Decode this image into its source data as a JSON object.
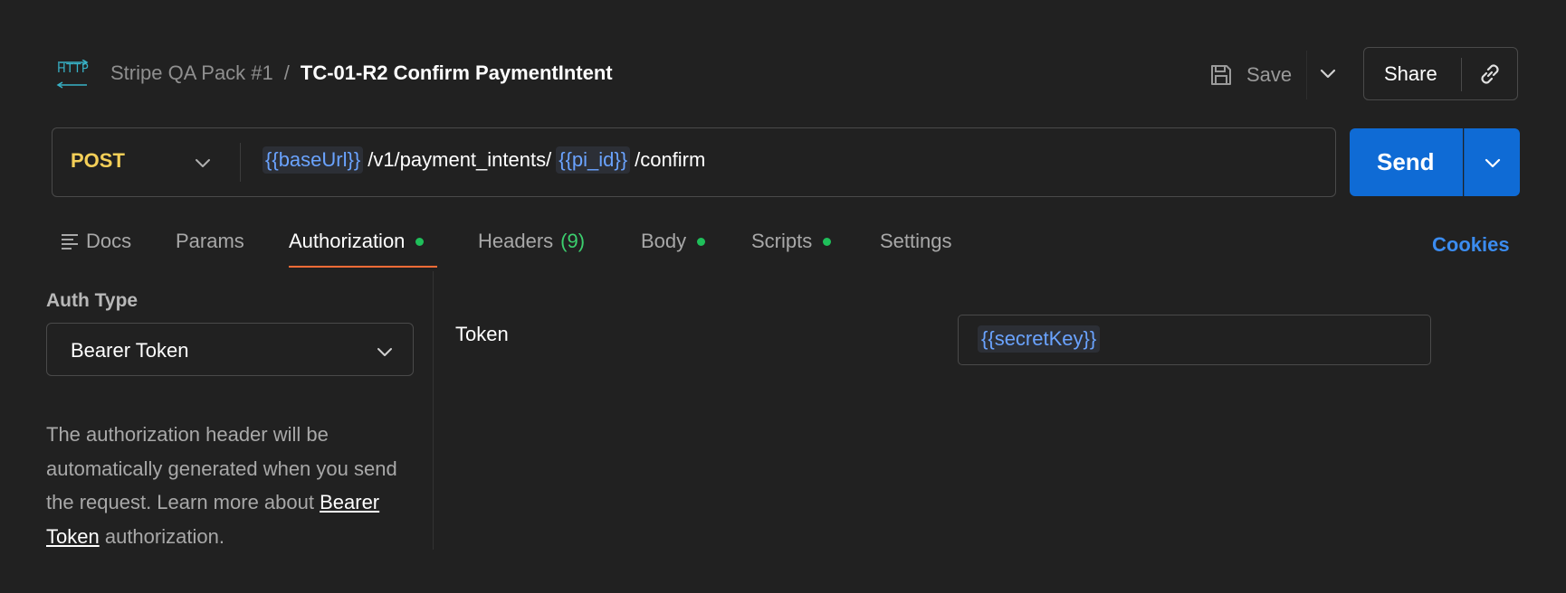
{
  "header": {
    "icon_text": "HTTP",
    "collection": "Stripe QA Pack #1",
    "separator": "/",
    "request_name": "TC-01-R2 Confirm PaymentIntent",
    "save_label": "Save",
    "share_label": "Share"
  },
  "request": {
    "method": "POST",
    "url_parts": [
      {
        "type": "var",
        "text": "{{baseUrl}}"
      },
      {
        "type": "text",
        "text": "/v1/payment_intents/"
      },
      {
        "type": "var",
        "text": "{{pi_id}}"
      },
      {
        "type": "text",
        "text": "/confirm"
      }
    ],
    "send_label": "Send"
  },
  "tabs": [
    {
      "label": "Docs",
      "active": false
    },
    {
      "label": "Params",
      "active": false
    },
    {
      "label": "Authorization",
      "active": true,
      "dot": true
    },
    {
      "label": "Headers",
      "count": "(9)",
      "active": false
    },
    {
      "label": "Body",
      "active": false,
      "dot": true
    },
    {
      "label": "Scripts",
      "active": false,
      "dot": true
    },
    {
      "label": "Settings",
      "active": false
    }
  ],
  "cookies_label": "Cookies",
  "auth": {
    "type_label": "Auth Type",
    "type_value": "Bearer Token",
    "description_pre": "The authorization header will be automatically generated when you send the request. Learn more about",
    "description_link": "Bearer Token",
    "description_post": "authorization.",
    "token_label": "Token",
    "token_value": "{{secretKey}}"
  },
  "colors": {
    "background": "#212121",
    "method": "#f4cf58",
    "send": "#0f6bd5",
    "variable": "#6aa3ff",
    "active_tab_underline": "#ff6c37",
    "dot": "#1fbf5a",
    "cookies": "#3b8cf0"
  }
}
